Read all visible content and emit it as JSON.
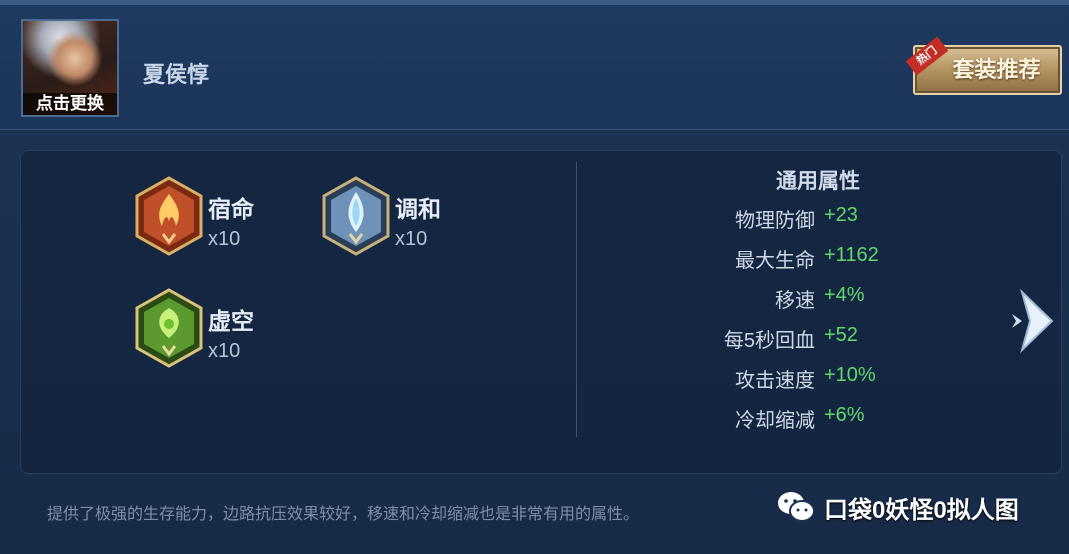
{
  "header": {
    "hero_name": "夏侯惇",
    "avatar_label": "点击更换",
    "preset_button": "套装推荐",
    "hot_tag": "热门"
  },
  "runes": [
    {
      "name": "宿命",
      "count": "x10",
      "icon": "red-flame-rune-icon",
      "color": "#c0502a"
    },
    {
      "name": "调和",
      "count": "x10",
      "icon": "blue-crystal-rune-icon",
      "color": "#6f93b8"
    },
    {
      "name": "虚空",
      "count": "x10",
      "icon": "green-leaf-rune-icon",
      "color": "#5a9a2e"
    }
  ],
  "attributes": {
    "title": "通用属性",
    "rows": [
      {
        "label": "物理防御",
        "value": "+23"
      },
      {
        "label": "最大生命",
        "value": "+1162"
      },
      {
        "label": "移速",
        "value": "+4%"
      },
      {
        "label": "每5秒回血",
        "value": "+52"
      },
      {
        "label": "攻击速度",
        "value": "+10%"
      },
      {
        "label": "冷却缩减",
        "value": "+6%"
      }
    ]
  },
  "description": "提供了极强的生存能力，边路抗压效果较好，移速和冷却缩减也是非常有用的属性。",
  "watermark": {
    "text": "口袋0妖怪0拟人图",
    "icon": "wechat-icon"
  },
  "colors": {
    "accent_value": "#63d86a",
    "button_gold": "#b39362",
    "hot_red": "#c32d25"
  }
}
